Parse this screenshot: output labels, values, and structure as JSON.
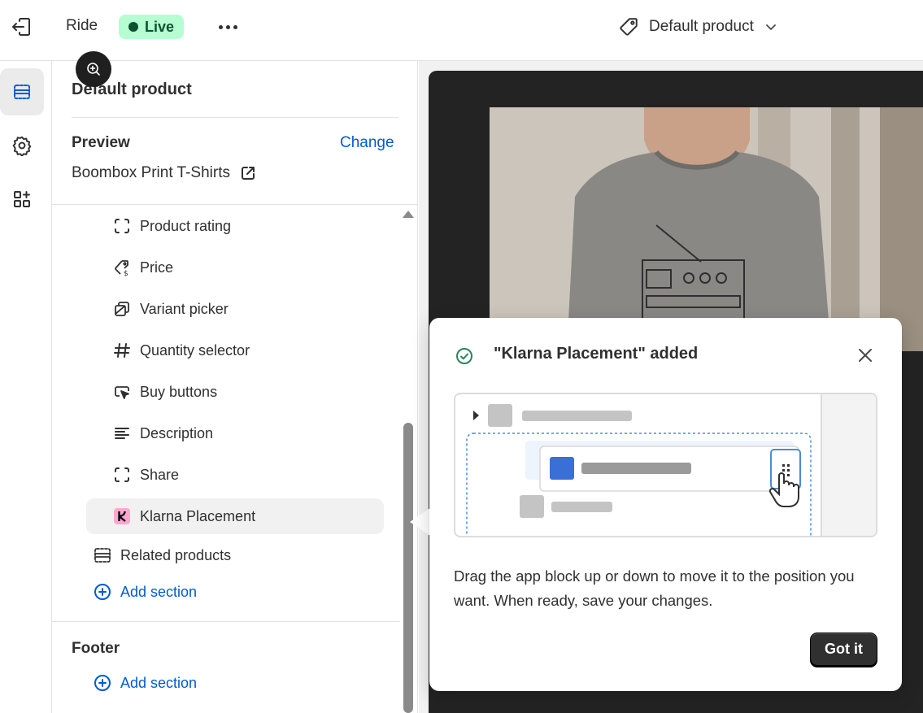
{
  "topbar": {
    "exit_icon": "exit-icon",
    "theme_name": "Ride",
    "status_badge": "Live",
    "more_icon": "more-horizontal-icon",
    "template_icon": "tag-icon",
    "template_name": "Default product",
    "chevron_icon": "chevron-down-icon"
  },
  "rail": {
    "items": [
      {
        "name": "sections-icon",
        "active": true
      },
      {
        "name": "settings-icon",
        "active": false
      },
      {
        "name": "apps-icon",
        "active": false
      }
    ]
  },
  "sidebar": {
    "title": "Default product",
    "preview_label": "Preview",
    "change_label": "Change",
    "preview_value": "Boombox Print T-Shirts",
    "blocks": [
      {
        "label": "Product rating",
        "icon": "dashed-square-icon"
      },
      {
        "label": "Price",
        "icon": "price-tag-icon"
      },
      {
        "label": "Variant picker",
        "icon": "variant-icon"
      },
      {
        "label": "Quantity selector",
        "icon": "hash-icon"
      },
      {
        "label": "Buy buttons",
        "icon": "cursor-button-icon"
      },
      {
        "label": "Description",
        "icon": "text-lines-icon"
      },
      {
        "label": "Share",
        "icon": "dashed-square-icon"
      },
      {
        "label": "Klarna Placement",
        "icon": "klarna-logo-icon"
      }
    ],
    "related_products": "Related products",
    "add_section": "Add section",
    "footer_label": "Footer",
    "footer_add_section": "Add section"
  },
  "popover": {
    "title": "\"Klarna Placement\" added",
    "body": "Drag the app block up or down to move it to the position you want. When ready, save your changes.",
    "button": "Got it"
  },
  "colors": {
    "accent": "#005bd3",
    "live_bg": "#b4fed2",
    "live_text": "#0c5132",
    "klarna_pink": "#ffa8cd",
    "success": "#29845a"
  }
}
